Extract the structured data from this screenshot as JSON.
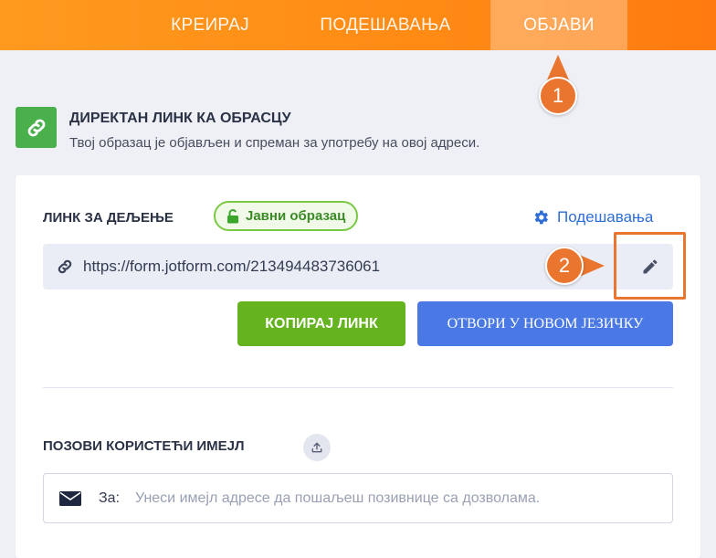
{
  "tabs": [
    {
      "label": "КРЕИРАЈ"
    },
    {
      "label": "ПОДЕШАВАЊА"
    },
    {
      "label": "ОБЈАВИ",
      "active": true
    }
  ],
  "callouts": {
    "first": "1",
    "second": "2"
  },
  "header": {
    "title": "ДИРЕКТАН ЛИНК КА ОБРАСЦУ",
    "subtitle": "Твој образац је објављен и спреман за употребу на овој адреси.",
    "icon": "link-icon"
  },
  "share": {
    "label": "ЛИНК ЗА ДЕЉЕЊЕ",
    "badge": "Јавни образац",
    "settings": "Подешавања",
    "url": "https://form.jotform.com/213494483736061",
    "copy_button": "КОПИРАЈ ЛИНК",
    "open_button": "ОТВОРИ У НОВОМ ЈЕЗИЧКУ"
  },
  "invite": {
    "label": "ПОЗОВИ КОРИСТЕЋИ ИМЕЈЛ",
    "to_label": "За:",
    "placeholder": "Унеси имејл адресе да пошаљеш позивнице са дозволама."
  },
  "colors": {
    "accent_orange": "#ff8a14",
    "callout": "#e9752e",
    "green": "#64b31f",
    "blue": "#4a78e5",
    "link_blue": "#2f6ed8"
  }
}
